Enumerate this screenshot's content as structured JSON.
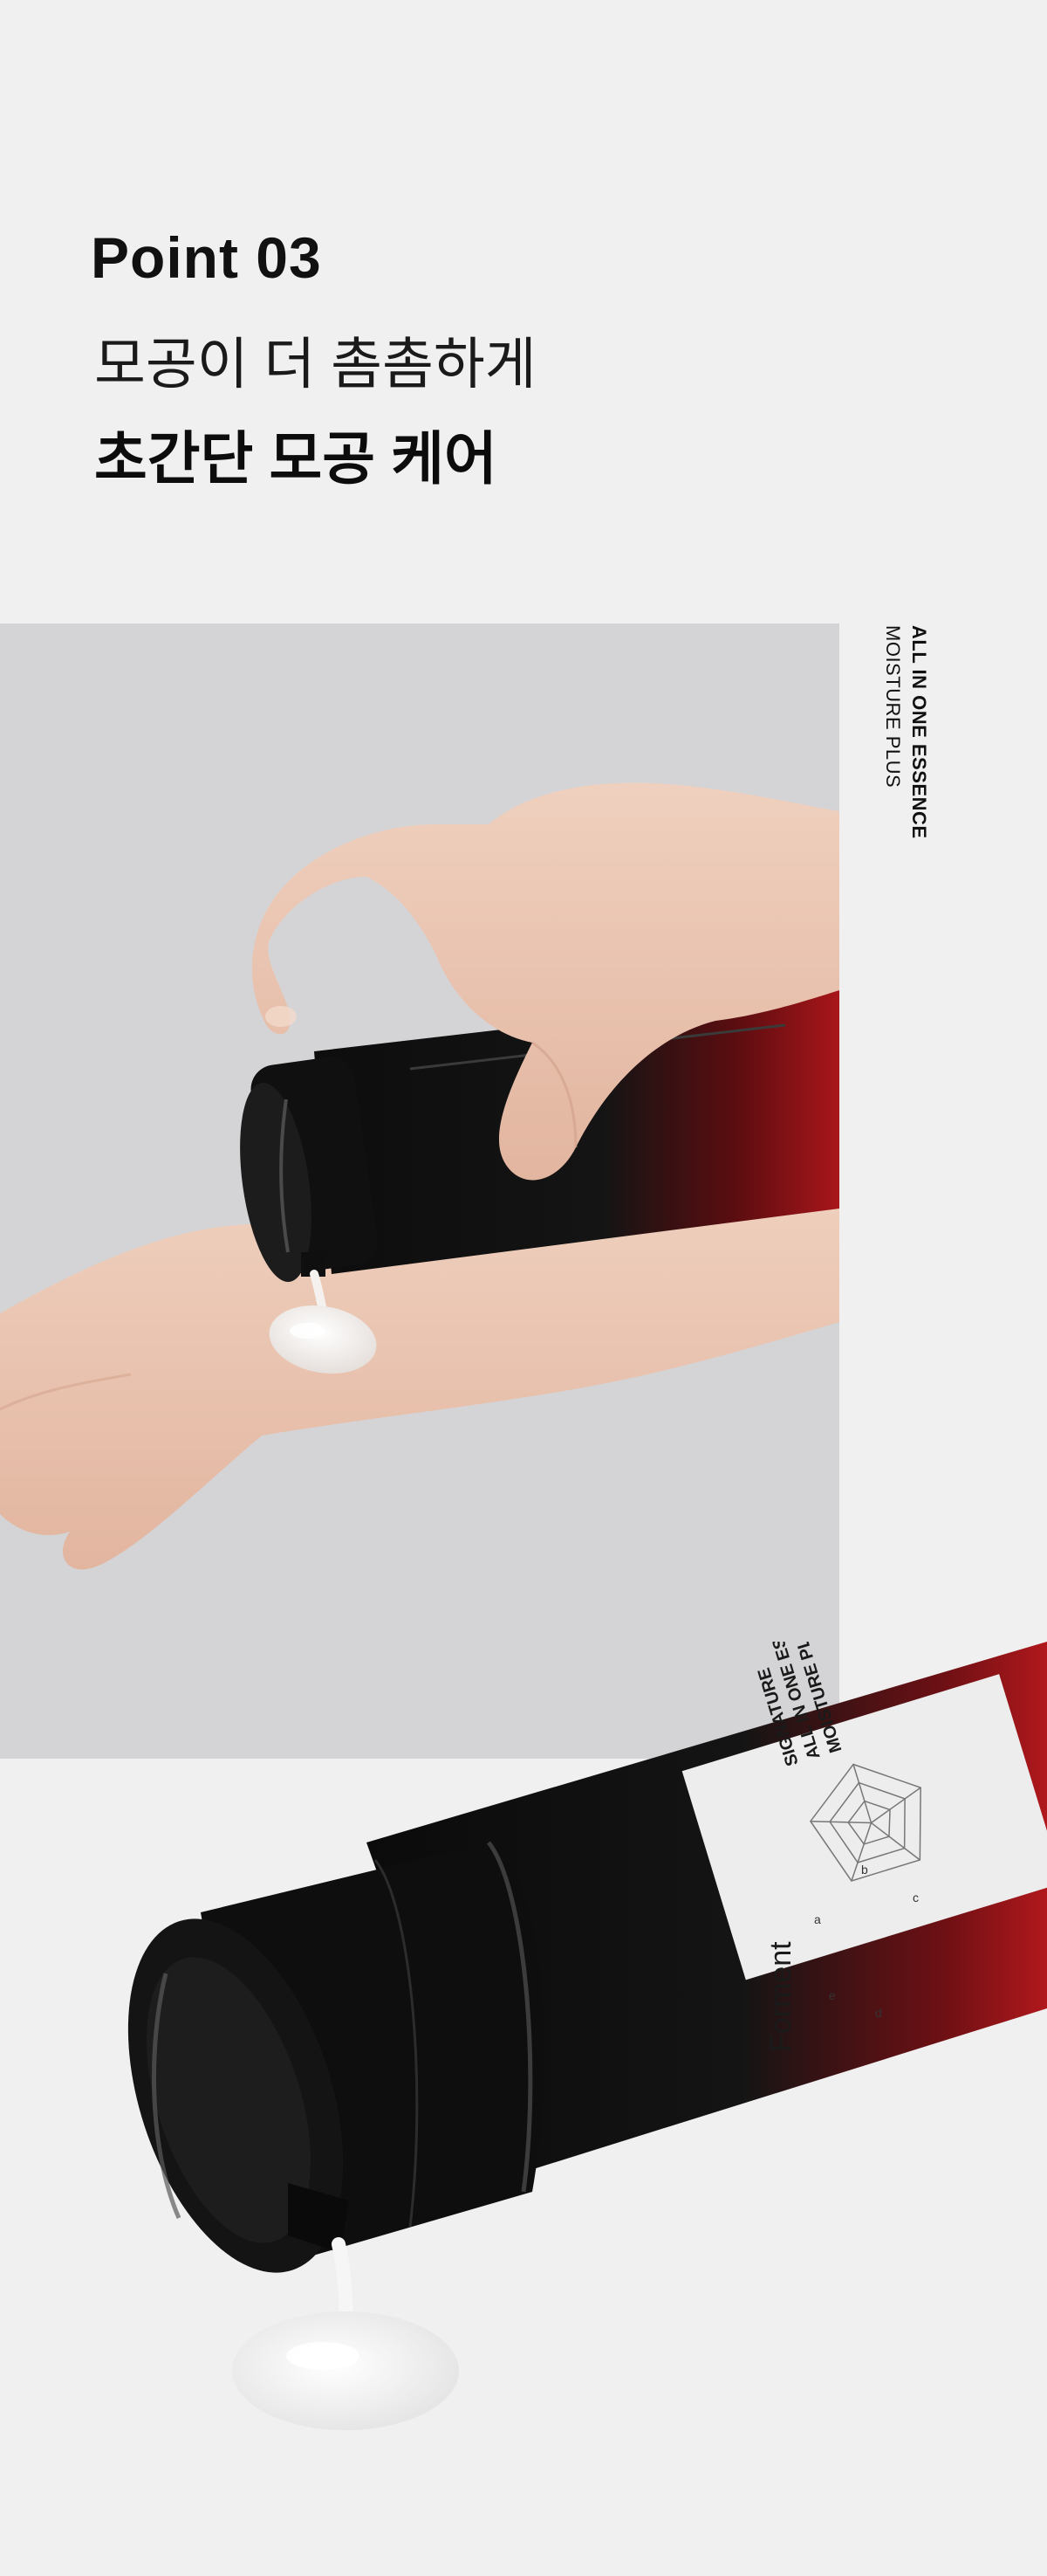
{
  "section": {
    "point_title": "Point 03",
    "subtitle": "모공이 더 촘촘하게",
    "headline": "초간단 모공 케어"
  },
  "product_label": {
    "line_1": "ALL IN ONE ESSENCE",
    "line_2": "MOISTURE PLUS"
  },
  "bottle_label": {
    "brand": "Forment",
    "line_1": "SIGNATURE",
    "line_2": "ALL IN ONE ESSENCE",
    "line_3": "MOISTURE PLUS",
    "chart_letters": [
      "a",
      "b",
      "c",
      "d",
      "e"
    ]
  },
  "colors": {
    "page_background": "#f0f0f0",
    "photo_background": "#d4d4d6",
    "bottle_black": "#0d0d0d",
    "bottle_red": "#a8161a",
    "skin": "#e9c4b0"
  }
}
